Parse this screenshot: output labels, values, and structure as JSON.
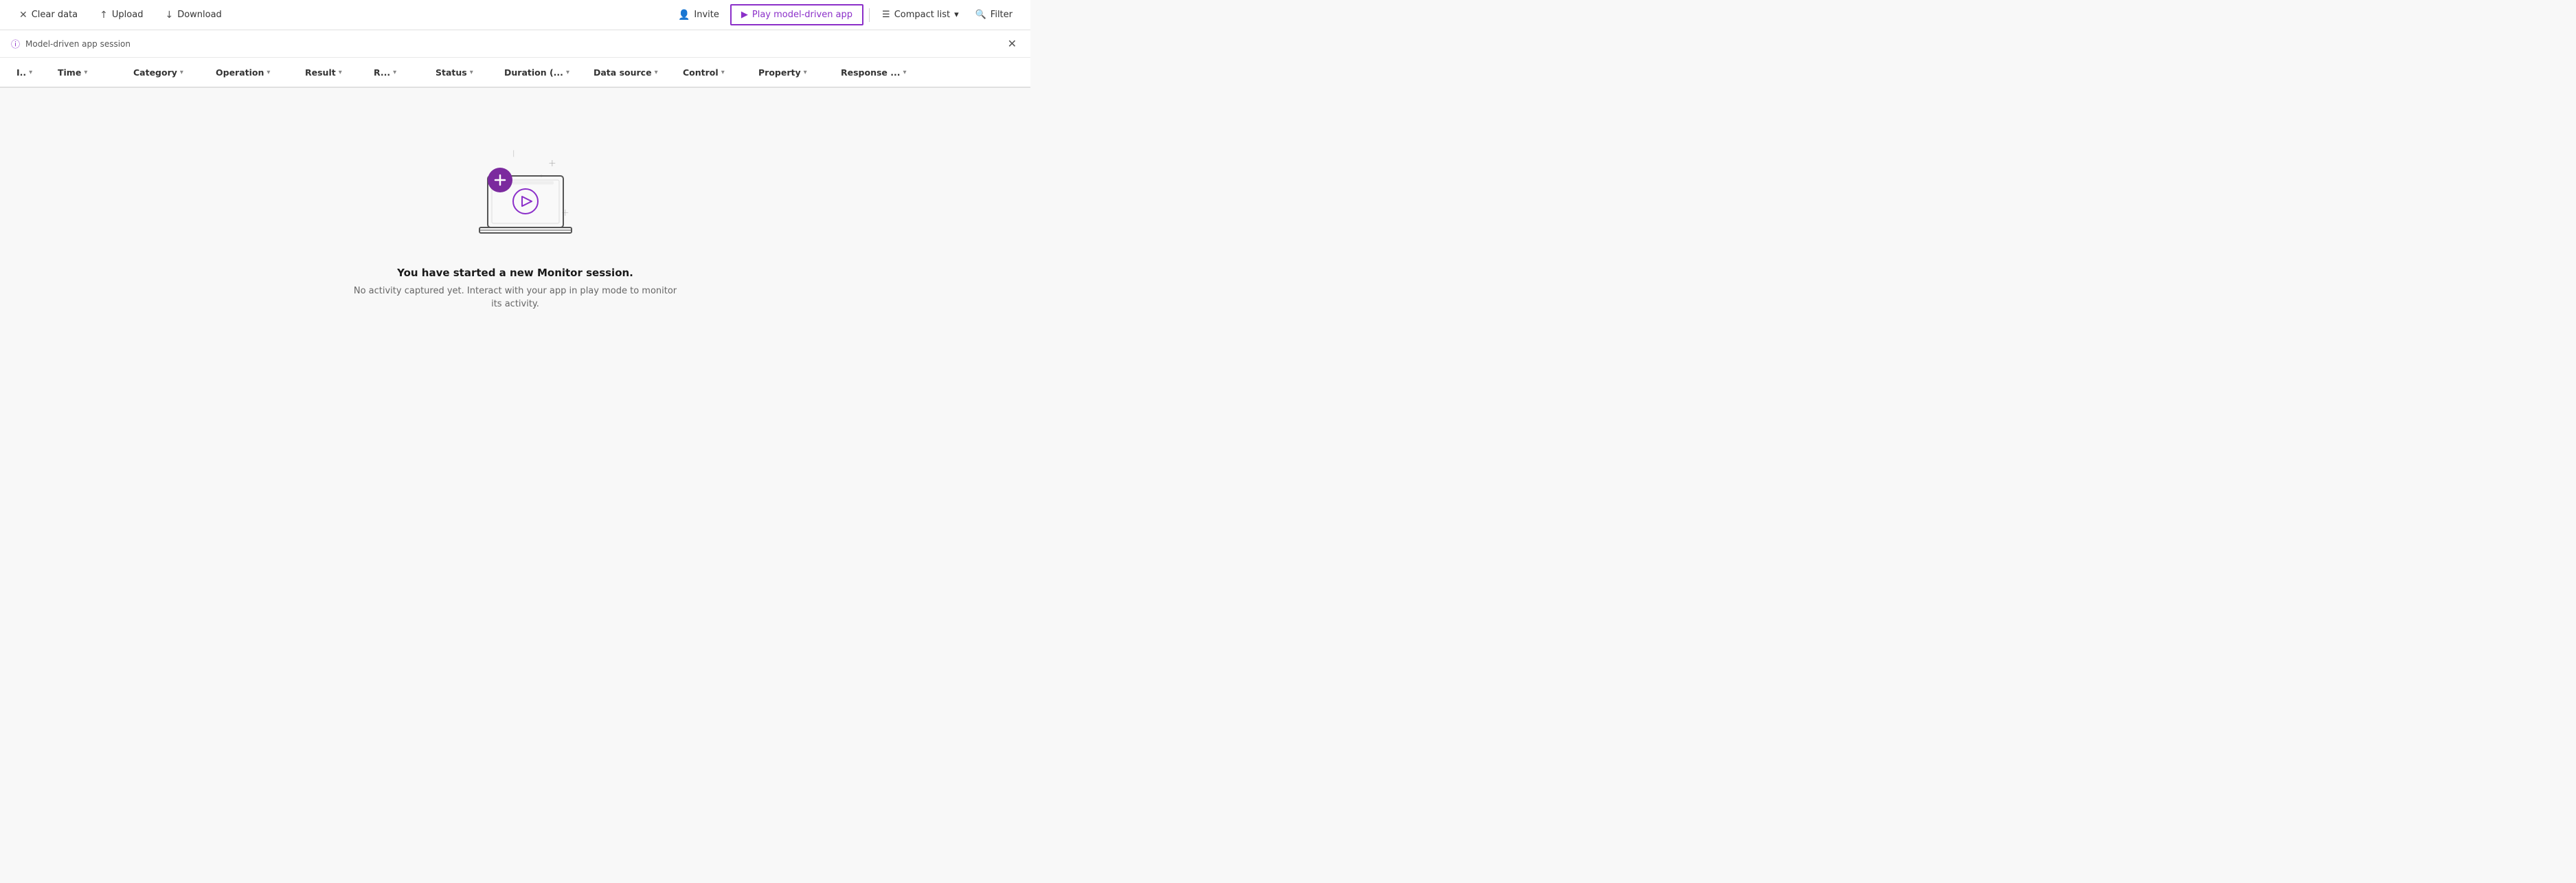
{
  "toolbar": {
    "clear_data_label": "Clear data",
    "upload_label": "Upload",
    "download_label": "Download",
    "invite_label": "Invite",
    "play_model_driven_app_label": "Play model-driven app",
    "compact_list_label": "Compact list",
    "filter_label": "Filter"
  },
  "session_bar": {
    "info_text": "Model-driven app session"
  },
  "columns": [
    {
      "id": "col-id",
      "label": "I.."
    },
    {
      "id": "col-time",
      "label": "Time"
    },
    {
      "id": "col-category",
      "label": "Category"
    },
    {
      "id": "col-operation",
      "label": "Operation"
    },
    {
      "id": "col-result",
      "label": "Result"
    },
    {
      "id": "col-r",
      "label": "R..."
    },
    {
      "id": "col-status",
      "label": "Status"
    },
    {
      "id": "col-duration",
      "label": "Duration (..."
    },
    {
      "id": "col-datasource",
      "label": "Data source"
    },
    {
      "id": "col-control",
      "label": "Control"
    },
    {
      "id": "col-property",
      "label": "Property"
    },
    {
      "id": "col-response",
      "label": "Response ..."
    }
  ],
  "empty_state": {
    "title": "You have started a new Monitor session.",
    "subtitle": "No activity captured yet. Interact with your app in play mode to monitor its activity."
  },
  "colors": {
    "purple_accent": "#8b2fc9",
    "border": "#e0e0e0"
  }
}
